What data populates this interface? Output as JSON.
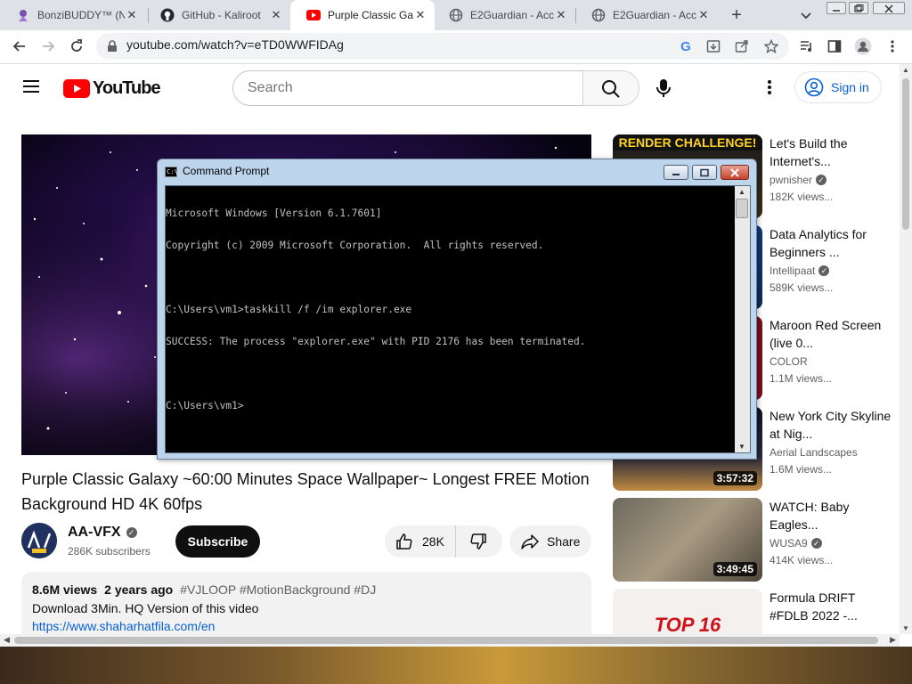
{
  "browser": {
    "tabs": [
      {
        "title": "BonziBUDDY™ (N",
        "icon": "bonzi-purple-icon",
        "active": false
      },
      {
        "title": "GitHub - Kaliroot",
        "icon": "github-icon",
        "active": false
      },
      {
        "title": "Purple Classic Gal",
        "icon": "youtube-icon",
        "active": true
      },
      {
        "title": "E2Guardian - Acc",
        "icon": "globe-icon",
        "active": false
      },
      {
        "title": "E2Guardian - Acc",
        "icon": "globe-icon",
        "active": false
      }
    ],
    "new_tab": "+",
    "address": "youtube.com/watch?v=eTD0WWFIDAg"
  },
  "youtube": {
    "logo_text": "YouTube",
    "search_placeholder": "Search",
    "sign_in": "Sign in",
    "video_title": "Purple Classic Galaxy ~60:00 Minutes Space Wallpaper~ Longest FREE Motion Background HD 4K 60fps",
    "channel": {
      "name": "AA-VFX",
      "subscribers": "286K subscribers",
      "avatar_text": "AA VFX"
    },
    "subscribe": "Subscribe",
    "likes": "28K",
    "share": "Share",
    "description": {
      "views": "8.6M views",
      "age": "2 years ago",
      "tags": "#VJLOOP #MotionBackground #DJ",
      "line1": "Download 3Min. HQ Version of this video",
      "link": "https://www.shaharhatfila.com/en"
    },
    "recommendations": [
      {
        "title": "Let's Build the Internet's...",
        "channel": "pwnisher",
        "verified": true,
        "views": "182K views...",
        "thumb_text": "RENDER CHALLENGE!",
        "duration": ""
      },
      {
        "title": "Data Analytics for Beginners ...",
        "channel": "Intellipaat",
        "verified": true,
        "views": "589K views...",
        "thumb_text": "",
        "duration": ""
      },
      {
        "title": "Maroon Red Screen (live 0...",
        "channel": "COLOR",
        "verified": false,
        "views": "1.1M views...",
        "thumb_text": "",
        "duration": ""
      },
      {
        "title": "New York City Skyline at Nig...",
        "channel": "Aerial Landscapes",
        "verified": false,
        "views": "1.6M views...",
        "thumb_text": "",
        "duration": "3:57:32"
      },
      {
        "title": "WATCH: Baby Eagles...",
        "channel": "WUSA9",
        "verified": true,
        "views": "414K views...",
        "thumb_text": "",
        "duration": "3:49:45"
      },
      {
        "title": "Formula DRIFT #FDLB 2022 -...",
        "channel": "",
        "verified": false,
        "views": "",
        "thumb_text": "TOP 16",
        "duration": ""
      }
    ]
  },
  "cmd": {
    "title": "Command Prompt",
    "lines": [
      "Microsoft Windows [Version 6.1.7601]",
      "Copyright (c) 2009 Microsoft Corporation.  All rights reserved.",
      "",
      "C:\\Users\\vm1>taskkill /f /im explorer.exe",
      "SUCCESS: The process \"explorer.exe\" with PID 2176 has been terminated.",
      "",
      "C:\\Users\\vm1>"
    ]
  },
  "colors": {
    "youtube_red": "#ff0000",
    "signin_blue": "#065fd4",
    "tabstrip": "#dee1e6"
  }
}
